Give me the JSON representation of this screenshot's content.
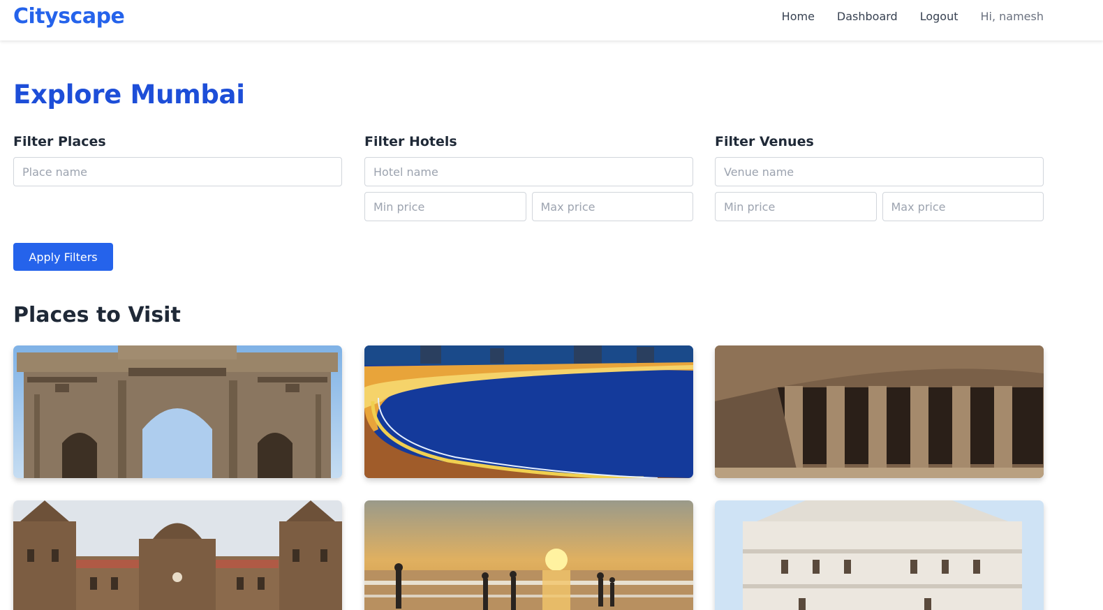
{
  "nav": {
    "brand": "Cityscape",
    "links": [
      {
        "label": "Home"
      },
      {
        "label": "Dashboard"
      },
      {
        "label": "Logout"
      }
    ],
    "greeting": "Hi, namesh"
  },
  "page": {
    "title": "Explore Mumbai"
  },
  "filters": {
    "places": {
      "heading": "Filter Places",
      "name_placeholder": "Place name"
    },
    "hotels": {
      "heading": "Filter Hotels",
      "name_placeholder": "Hotel name",
      "min_placeholder": "Min price",
      "max_placeholder": "Max price"
    },
    "venues": {
      "heading": "Filter Venues",
      "name_placeholder": "Venue name",
      "min_placeholder": "Min price",
      "max_placeholder": "Max price"
    },
    "apply_label": "Apply Filters"
  },
  "places_section": {
    "title": "Places to Visit",
    "cards": [
      {
        "image": "gateway-of-india-photo"
      },
      {
        "image": "marine-drive-night-photo"
      },
      {
        "image": "rock-cut-caves-photo"
      },
      {
        "image": "victoria-terminus-photo"
      },
      {
        "image": "beach-sunset-photo"
      },
      {
        "image": "white-temple-photo"
      }
    ]
  },
  "colors": {
    "brand": "#2563eb",
    "title": "#1d4ed8",
    "button": "#2563eb",
    "text": "#1f2937"
  }
}
